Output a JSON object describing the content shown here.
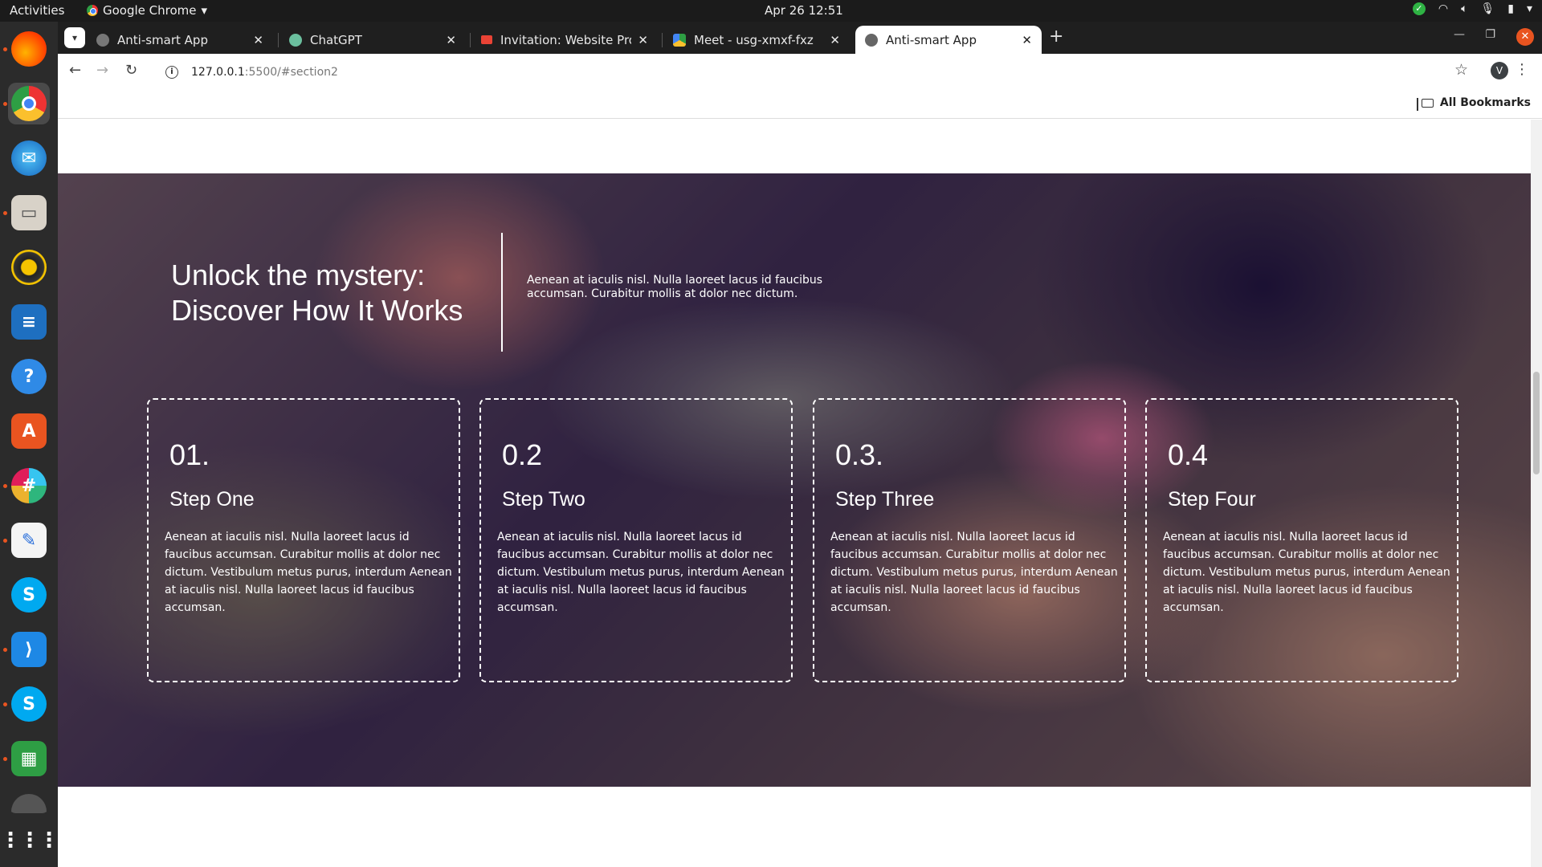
{
  "system": {
    "activities": "Activities",
    "app_name": "Google Chrome",
    "clock": "Apr 26  12:51"
  },
  "dock": {
    "items": [
      "Firefox",
      "Google Chrome",
      "Thunderbird",
      "Files",
      "Rhythmbox",
      "LibreOffice Writer",
      "Help",
      "Ubuntu Software",
      "Slack",
      "Text Editor",
      "Skype",
      "Visual Studio Code",
      "Skype",
      "LibreOffice Calc",
      "Ubuntu",
      "Show Applications"
    ]
  },
  "browser": {
    "tabs": [
      {
        "title": "Anti-smart App"
      },
      {
        "title": "ChatGPT"
      },
      {
        "title": "Invitation: Website Prog"
      },
      {
        "title": "Meet - usg-xmxf-fxz"
      },
      {
        "title": "Anti-smart App"
      }
    ],
    "url_host": "127.0.0.1",
    "url_path": ":5500/#section2",
    "profile_initial": "V",
    "all_bookmarks": "All Bookmarks"
  },
  "page": {
    "hero": {
      "title_line1": "Unlock the mystery:",
      "title_line2": "Discover How It Works",
      "text": "Aenean at iaculis nisl. Nulla laoreet lacus id faucibus accumsan. Curabitur mollis at dolor nec dictum."
    },
    "steps": [
      {
        "number": "01.",
        "title": "Step One",
        "text": "Aenean at iaculis nisl. Nulla laoreet lacus id faucibus accumsan. Curabitur mollis at dolor nec dictum. Vestibulum metus purus, interdum Aenean at iaculis nisl. Nulla laoreet lacus id faucibus accumsan."
      },
      {
        "number": "0.2",
        "title": "Step Two",
        "text": "Aenean at iaculis nisl. Nulla laoreet lacus id faucibus accumsan. Curabitur mollis at dolor nec dictum. Vestibulum metus purus, interdum Aenean at iaculis nisl. Nulla laoreet lacus id faucibus accumsan."
      },
      {
        "number": "0.3.",
        "title": "Step Three",
        "text": "Aenean at iaculis nisl. Nulla laoreet lacus id faucibus accumsan. Curabitur mollis at dolor nec dictum. Vestibulum metus purus, interdum Aenean at iaculis nisl. Nulla laoreet lacus id faucibus accumsan."
      },
      {
        "number": "0.4",
        "title": "Step Four",
        "text": "Aenean at iaculis nisl. Nulla laoreet lacus id faucibus accumsan. Curabitur mollis at dolor nec dictum. Vestibulum metus purus, interdum Aenean at iaculis nisl. Nulla laoreet lacus id faucibus accumsan."
      }
    ]
  },
  "colors": {
    "accent": "#e95420",
    "topbar": "#1b1b1b",
    "dock": "#2b2b2b"
  }
}
